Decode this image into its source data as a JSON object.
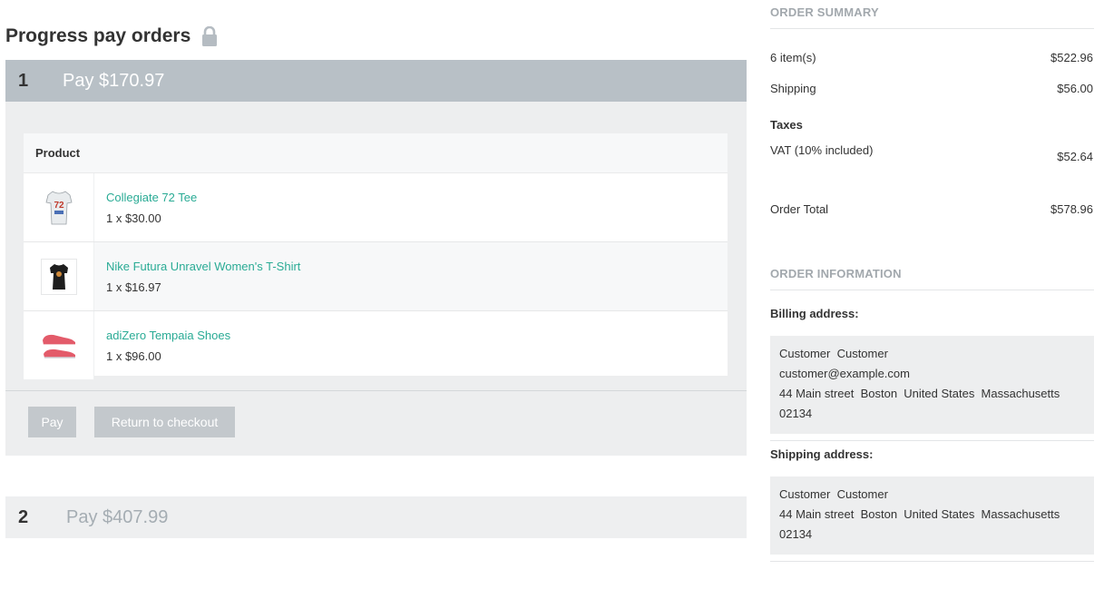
{
  "page": {
    "title": "Progress pay orders",
    "lock_icon": "lock-icon"
  },
  "steps": [
    {
      "number": "1",
      "label": "Pay $170.97",
      "table_header": "Product",
      "products": [
        {
          "name": "Collegiate 72 Tee",
          "qty": "1 x $30.00",
          "icon": "tshirt-image"
        },
        {
          "name": "Nike Futura Unravel Women's T-Shirt",
          "qty": "1 x $16.97",
          "icon": "womens-shirt-image"
        },
        {
          "name": "adiZero Tempaia Shoes",
          "qty": "1 x $96.00",
          "icon": "shoes-image"
        }
      ],
      "pay_label": "Pay",
      "return_label": "Return to checkout"
    },
    {
      "number": "2",
      "label": "Pay $407.99"
    }
  ],
  "summary": {
    "title": "ORDER SUMMARY",
    "items_label": "6 item(s)",
    "items_value": "$522.96",
    "shipping_label": "Shipping",
    "shipping_value": "$56.00",
    "taxes_label": "Taxes",
    "vat_label": "VAT (10% included)",
    "vat_value": "$52.64",
    "total_label": "Order Total",
    "total_value": "$578.96"
  },
  "info": {
    "title": "ORDER INFORMATION",
    "billing_label": "Billing address:",
    "billing_lines": [
      "Customer  Customer",
      "customer@example.com",
      "44 Main street  Boston  United States  Massachusetts",
      "02134"
    ],
    "shipping_label": "Shipping address:",
    "shipping_lines": [
      "Customer  Customer",
      "44 Main street  Boston  United States  Massachusetts",
      "02134"
    ]
  },
  "colors": {
    "accent_link": "#2aab95",
    "step_active": "#b8c0c6",
    "button": "#c3c8cc"
  }
}
